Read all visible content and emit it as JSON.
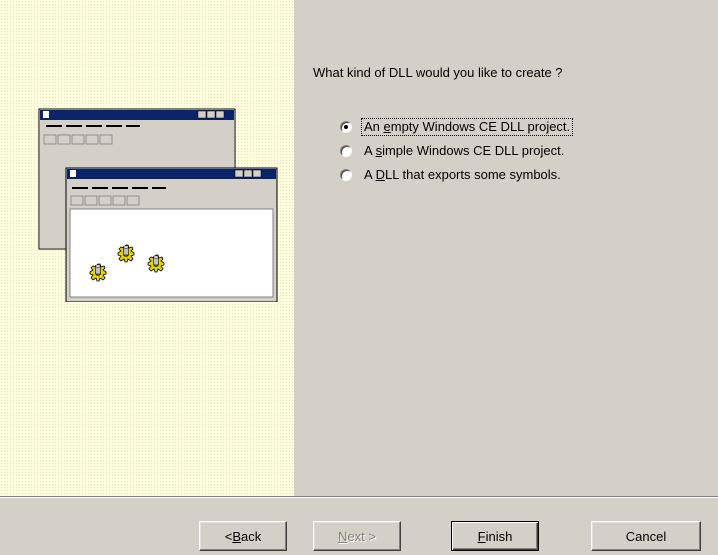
{
  "wizard": {
    "question": "What kind of DLL would you like to create ?",
    "options": [
      {
        "pre": "An ",
        "key": "e",
        "post": "mpty Windows CE DLL project.",
        "checked": true
      },
      {
        "pre": "A ",
        "key": "s",
        "post": "imple Windows CE DLL project.",
        "checked": false
      },
      {
        "pre": "A ",
        "key": "D",
        "post": "LL that exports some symbols.",
        "checked": false
      }
    ],
    "illustration_icon": "dll-wizard-illustration"
  },
  "buttons": {
    "back": {
      "pre": "< ",
      "key": "B",
      "post": "ack"
    },
    "next": {
      "pre": "",
      "key": "N",
      "post": "ext >"
    },
    "finish": {
      "pre": "",
      "key": "F",
      "post": "inish"
    },
    "cancel": "Cancel"
  },
  "colors": {
    "dialog_bg": "#d4d0c8",
    "panel_bg": "#fffee0",
    "titlebar": "#0a246a",
    "gear": "#e0d000"
  }
}
